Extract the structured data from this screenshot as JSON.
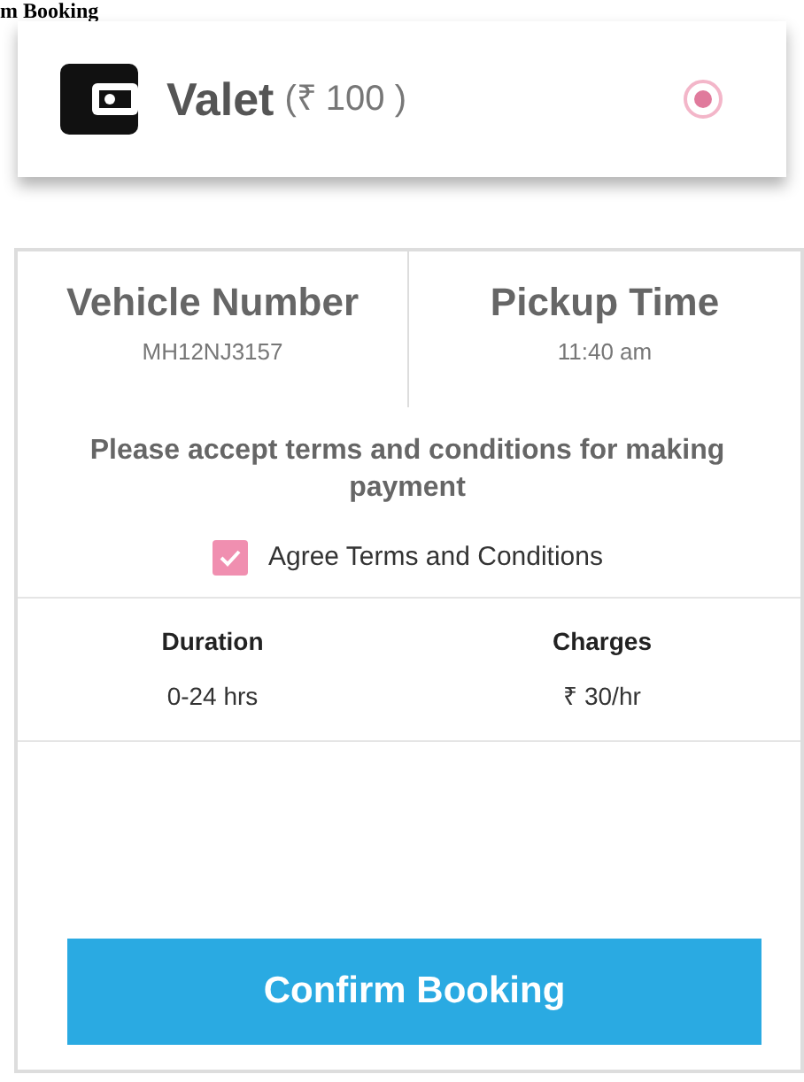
{
  "page_heading": "m Booking",
  "option": {
    "label": "Valet",
    "price": "(₹ 100 )",
    "selected": true
  },
  "details": [
    {
      "label": "Vehicle Number",
      "value": "MH12NJ3157"
    },
    {
      "label": "Pickup Time",
      "value": "11:40 am"
    }
  ],
  "notice": "Please accept terms and conditions for making payment",
  "agree": {
    "label": "Agree Terms and Conditions",
    "checked": true
  },
  "table": {
    "columns": [
      "Duration",
      "Charges"
    ],
    "rows": [
      [
        "0-24 hrs",
        "₹ 30/hr"
      ]
    ]
  },
  "confirm_button": "Confirm Booking"
}
